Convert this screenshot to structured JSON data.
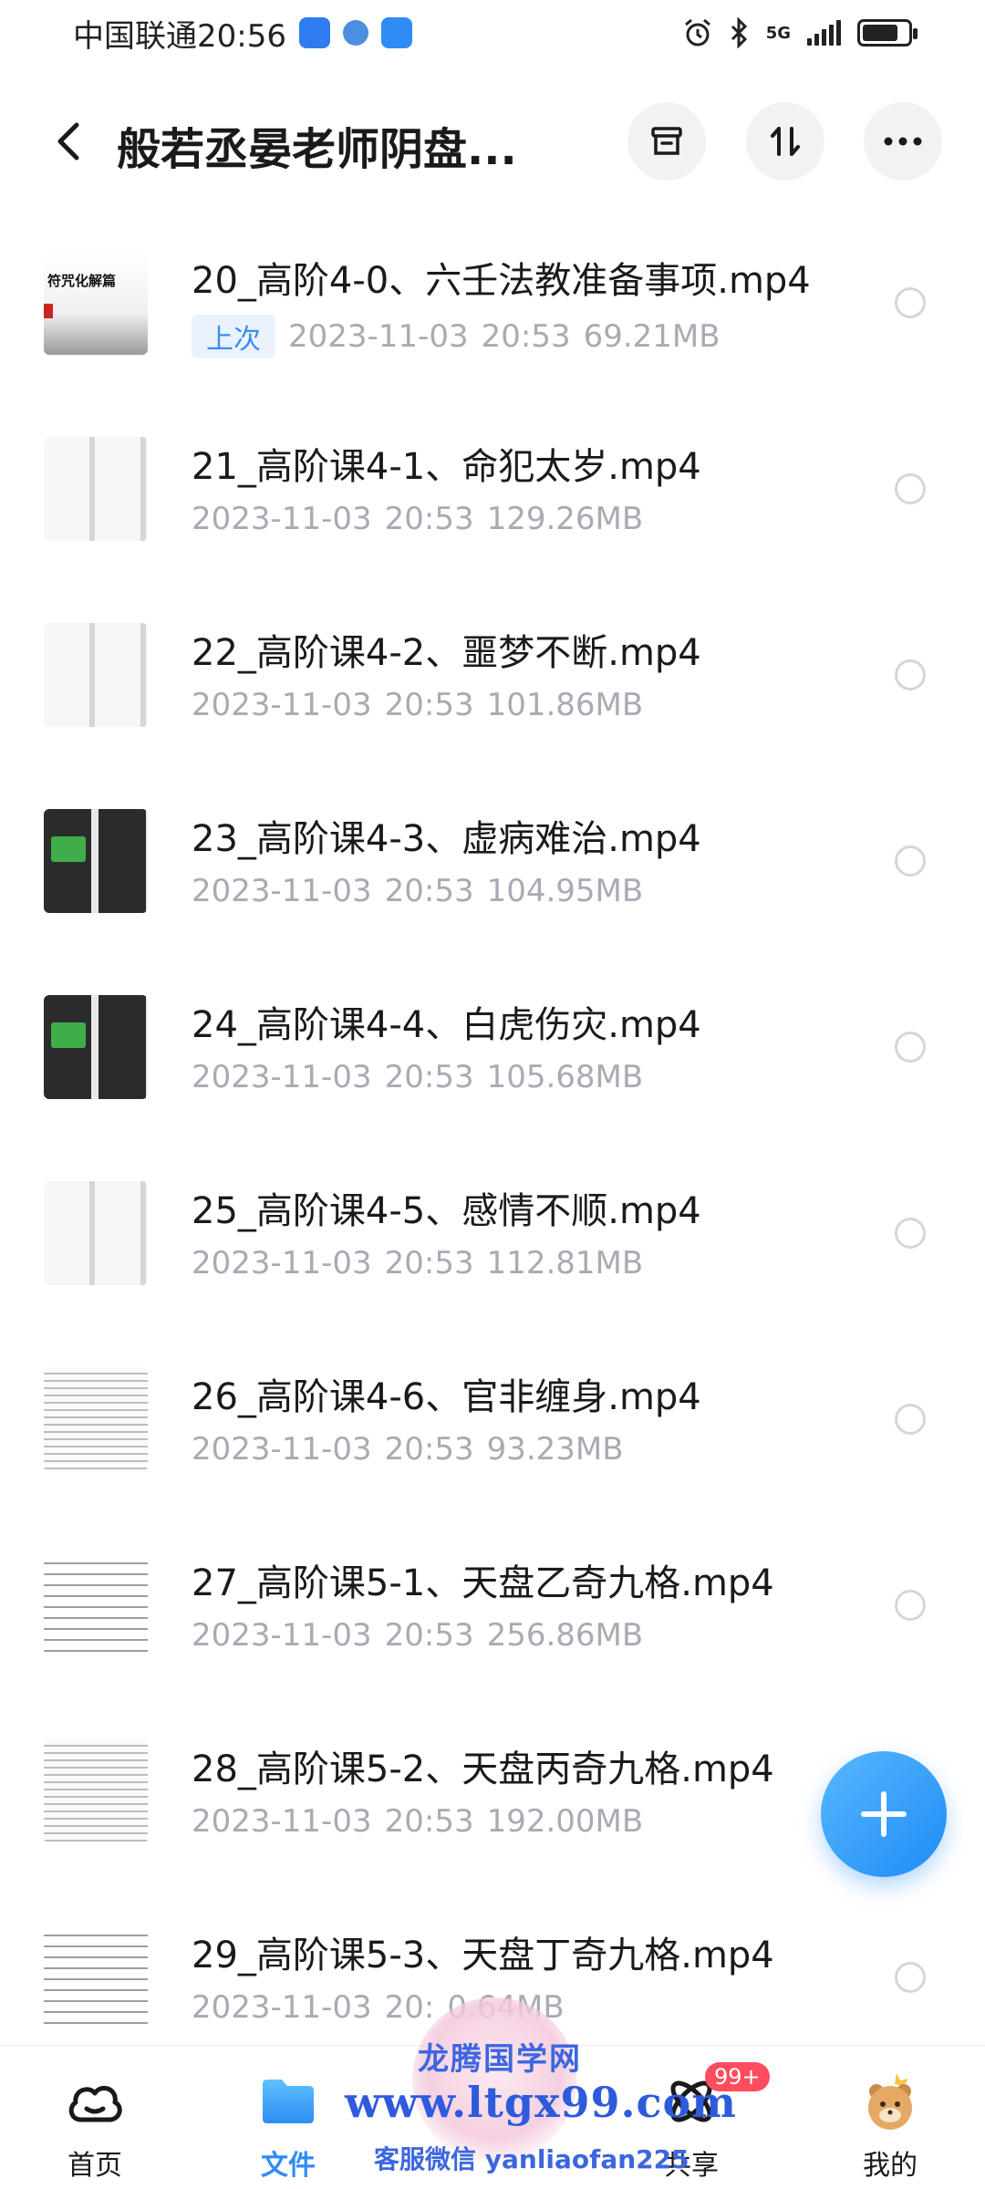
{
  "status_bar": {
    "carrier_time": "中国联通20:56",
    "network_label": "5G",
    "battery_level": 0.8
  },
  "header": {
    "title": "般若丞晏老师阴盘...",
    "back_icon": "chevron-left-icon",
    "actions": [
      "archive-icon",
      "sort-icon",
      "more-icon"
    ]
  },
  "files": [
    {
      "name": "20_高阶4-0、六壬法教准备事项.mp4",
      "badge": "上次",
      "date": "2023-11-03",
      "time": "20:53",
      "size": "69.21MB",
      "thumb_text": "符咒化解篇"
    },
    {
      "name": "21_高阶课4-1、命犯太岁.mp4",
      "badge": "",
      "date": "2023-11-03",
      "time": "20:53",
      "size": "129.26MB",
      "thumb_text": ""
    },
    {
      "name": "22_高阶课4-2、噩梦不断.mp4",
      "badge": "",
      "date": "2023-11-03",
      "time": "20:53",
      "size": "101.86MB",
      "thumb_text": ""
    },
    {
      "name": "23_高阶课4-3、虚病难治.mp4",
      "badge": "",
      "date": "2023-11-03",
      "time": "20:53",
      "size": "104.95MB",
      "thumb_text": ""
    },
    {
      "name": "24_高阶课4-4、白虎伤灾.mp4",
      "badge": "",
      "date": "2023-11-03",
      "time": "20:53",
      "size": "105.68MB",
      "thumb_text": ""
    },
    {
      "name": "25_高阶课4-5、感情不顺.mp4",
      "badge": "",
      "date": "2023-11-03",
      "time": "20:53",
      "size": "112.81MB",
      "thumb_text": ""
    },
    {
      "name": "26_高阶课4-6、官非缠身.mp4",
      "badge": "",
      "date": "2023-11-03",
      "time": "20:53",
      "size": "93.23MB",
      "thumb_text": ""
    },
    {
      "name": "27_高阶课5-1、天盘乙奇九格.mp4",
      "badge": "",
      "date": "2023-11-03",
      "time": "20:53",
      "size": "256.86MB",
      "thumb_text": ""
    },
    {
      "name": "28_高阶课5-2、天盘丙奇九格.mp4",
      "badge": "",
      "date": "2023-11-03",
      "time": "20:53",
      "size": "192.00MB",
      "thumb_text": ""
    },
    {
      "name": "29_高阶课5-3、天盘丁奇九格.mp4",
      "badge": "",
      "date": "2023-11-03",
      "time": "20:",
      "size": "0.64MB",
      "thumb_text": ""
    }
  ],
  "fab": {
    "icon": "plus-icon"
  },
  "bottom_nav": [
    {
      "label": "首页",
      "icon": "cloud-home-icon",
      "active": false
    },
    {
      "label": "文件",
      "icon": "folder-icon",
      "active": true
    },
    {
      "label": "",
      "icon": "",
      "active": false
    },
    {
      "label": "共享",
      "icon": "share-orbit-icon",
      "active": false,
      "badge": "99+"
    },
    {
      "label": "我的",
      "icon": "avatar-icon",
      "active": false
    }
  ],
  "watermark": {
    "title": "龙腾国学网",
    "url": "www.ltgx99.com",
    "contact": "客服微信 yanliaofan225"
  },
  "colors": {
    "accent": "#2f8cf5",
    "badge_bg": "#eaf3fd",
    "meta_text": "#a8abb3",
    "nav_badge": "#ff4d5e"
  }
}
